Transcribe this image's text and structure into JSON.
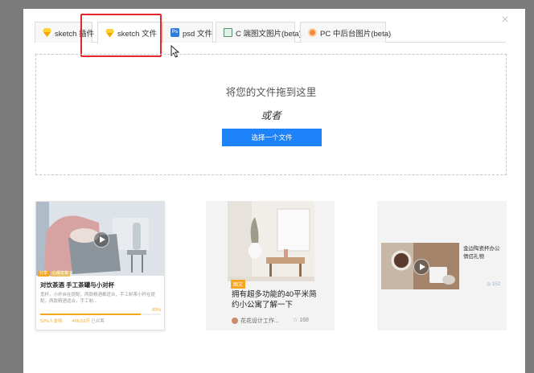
{
  "tabs": [
    {
      "label": "sketch 插件",
      "icon": "sketch-icon",
      "active": false
    },
    {
      "label": "sketch 文件",
      "icon": "sketch-icon",
      "active": true
    },
    {
      "label": "psd 文件",
      "icon": "photoshop-icon",
      "active": false
    },
    {
      "label": "C 端图文图片(beta)",
      "icon": "image-icon",
      "active": false
    },
    {
      "label": "PC 中后台图片(beta)",
      "icon": "pc-icon",
      "active": false
    }
  ],
  "dropzone": {
    "title": "将您的文件拖到这里",
    "or": "或者",
    "button": "选择一个文件"
  },
  "cards": {
    "card1": {
      "tags": [
        "分享",
        "心得文章"
      ],
      "title": "对饮茶酒 手工茶罐与小对杯",
      "desc": "宽杯，小杯自在提配，两款精酒都适合，手工制茶小杯在提配，两款精酒适合，手工制...",
      "progress": 0.83,
      "percent_label": "83%",
      "stat1": "52%人支持",
      "stat2": "466.52万",
      "stat3": "已众筹"
    },
    "card2": {
      "badge": "图文",
      "title": "拥有超多功能的40平米简约小公寓了解一下",
      "author": "花花设计工作...",
      "likes": "☆ 168"
    },
    "card3": {
      "title": "金边陶瓷杯办公情侣礼物",
      "stat": "◎ 152"
    }
  },
  "colors": {
    "primary": "#1e82f8",
    "highlight": "#e6262b",
    "accent": "#f5a623"
  }
}
